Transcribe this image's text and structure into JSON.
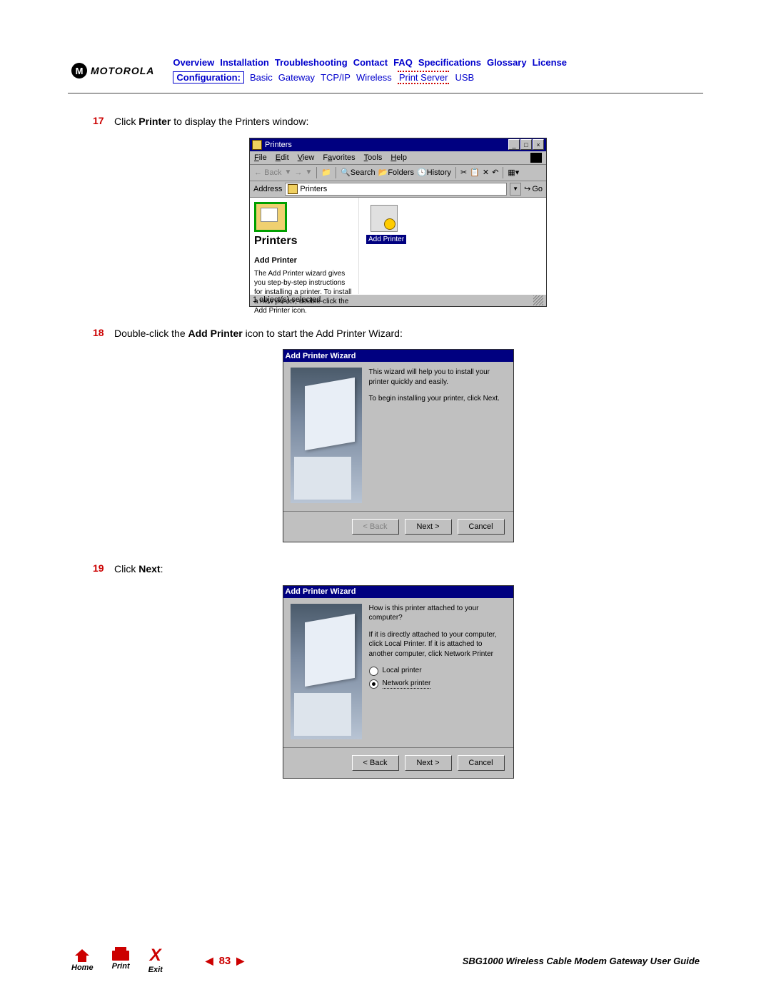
{
  "logo": {
    "brand": "MOTOROLA",
    "emblem": "M"
  },
  "nav": {
    "top": [
      "Overview",
      "Installation",
      "Troubleshooting",
      "Contact",
      "FAQ",
      "Specifications",
      "Glossary",
      "License"
    ],
    "config_label": "Configuration:",
    "sub": [
      "Basic",
      "Gateway",
      "TCP/IP",
      "Wireless",
      "Print Server",
      "USB"
    ],
    "current_sub_index": 4
  },
  "steps": {
    "s17": {
      "num": "17",
      "text_pre": "Click ",
      "bold": "Printer",
      "text_post": " to display the Printers window:"
    },
    "s18": {
      "num": "18",
      "text_pre": "Double-click the ",
      "bold": "Add Printer",
      "text_post": " icon to start the Add Printer Wizard:"
    },
    "s19": {
      "num": "19",
      "text_pre": "Click ",
      "bold": "Next",
      "text_post": ":"
    }
  },
  "printers_window": {
    "title": "Printers",
    "menus": [
      "File",
      "Edit",
      "View",
      "Favorites",
      "Tools",
      "Help"
    ],
    "toolbar": {
      "back": "Back",
      "search": "Search",
      "folders": "Folders",
      "history": "History"
    },
    "address_label": "Address",
    "address_value": "Printers",
    "go": "Go",
    "left_title": "Printers",
    "left_sub": "Add Printer",
    "left_desc": "The Add Printer wizard gives you step-by-step instructions for installing a printer. To install a new printer, double-click the Add Printer icon.",
    "item_label": "Add Printer",
    "status": "1 object(s) selected"
  },
  "wizard1": {
    "title": "Add Printer Wizard",
    "line1": "This wizard will help you to install your printer quickly and easily.",
    "line2": "To begin installing your printer, click Next.",
    "back": "< Back",
    "next": "Next >",
    "cancel": "Cancel"
  },
  "wizard2": {
    "title": "Add Printer Wizard",
    "q": "How is this printer attached to your computer?",
    "desc": "If it is directly attached to your computer, click Local Printer. If it is attached to another computer, click Network Printer",
    "opt1": "Local printer",
    "opt2": "Network printer",
    "back": "< Back",
    "next": "Next >",
    "cancel": "Cancel"
  },
  "footer": {
    "home": "Home",
    "print": "Print",
    "exit": "Exit",
    "page": "83",
    "guide": "SBG1000 Wireless Cable Modem Gateway User Guide"
  }
}
